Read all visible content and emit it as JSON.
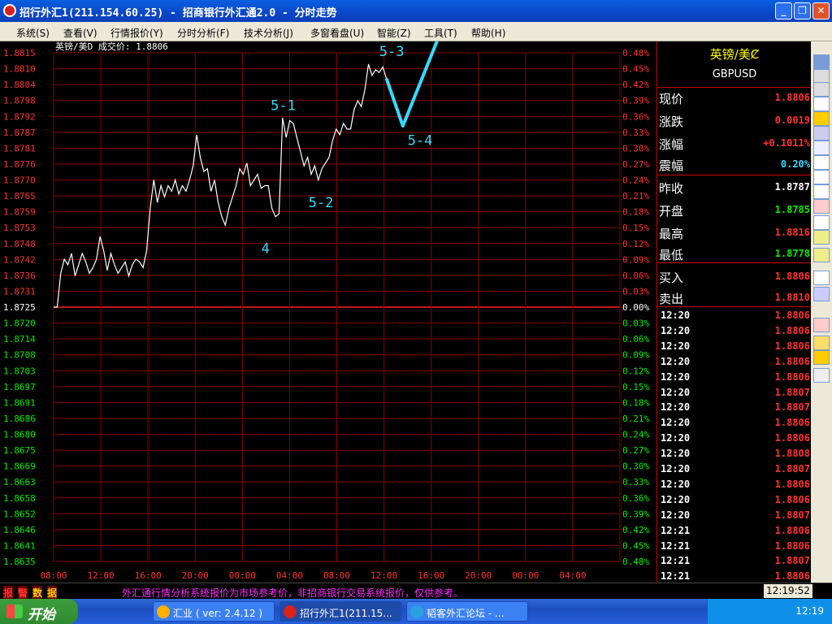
{
  "window": {
    "title": "招行外汇1(211.154.60.25) - 招商银行外汇通2.0 - 分时走势",
    "buttons": [
      "minimize",
      "restore",
      "close"
    ]
  },
  "menu": [
    "系统(S)",
    "查看(V)",
    "行情报价(Y)",
    "分时分析(F)",
    "技术分析(J)",
    "多窗看盘(U)",
    "智能(Z)",
    "工具(T)",
    "帮助(H)"
  ],
  "chart_header": {
    "label": "英镑/美D 成交价: 1.8806"
  },
  "chart_data": {
    "type": "line",
    "title": "英镑/美D 成交价: 1.8806",
    "base_price": 1.8725,
    "y_ticks_left": [
      "1.8815",
      "1.8810",
      "1.8804",
      "1.8798",
      "1.8792",
      "1.8787",
      "1.8781",
      "1.8776",
      "1.8770",
      "1.8765",
      "1.8759",
      "1.8753",
      "1.8748",
      "1.8742",
      "1.8736",
      "1.8731",
      "1.8725",
      "1.8720",
      "1.8714",
      "1.8708",
      "1.8703",
      "1.8697",
      "1.8691",
      "1.8686",
      "1.8680",
      "1.8675",
      "1.8669",
      "1.8663",
      "1.8658",
      "1.8652",
      "1.8646",
      "1.8641",
      "1.8635"
    ],
    "y_ticks_right": [
      "0.48%",
      "0.45%",
      "0.42%",
      "0.39%",
      "0.36%",
      "0.33%",
      "0.30%",
      "0.27%",
      "0.24%",
      "0.21%",
      "0.18%",
      "0.15%",
      "0.12%",
      "0.09%",
      "0.06%",
      "0.03%",
      "0.00%",
      "0.03%",
      "0.06%",
      "0.09%",
      "0.12%",
      "0.15%",
      "0.18%",
      "0.21%",
      "0.24%",
      "0.27%",
      "0.30%",
      "0.33%",
      "0.36%",
      "0.39%",
      "0.42%",
      "0.45%",
      "0.48%"
    ],
    "x_ticks": [
      "08:00",
      "12:00",
      "16:00",
      "20:00",
      "00:00",
      "04:00",
      "08:00",
      "12:00",
      "16:00",
      "20:00",
      "00:00",
      "04:00"
    ],
    "series": [
      {
        "values": [
          1.8725,
          1.8725,
          1.8737,
          1.8742,
          1.874,
          1.8744,
          1.8736,
          1.874,
          1.8744,
          1.8741,
          1.8737,
          1.8739,
          1.8742,
          1.875,
          1.8745,
          1.8738,
          1.8744,
          1.874,
          1.8737,
          1.8739,
          1.8741,
          1.8736,
          1.874,
          1.8742,
          1.8741,
          1.8739,
          1.8745,
          1.876,
          1.877,
          1.8762,
          1.8768,
          1.8764,
          1.8768,
          1.8766,
          1.877,
          1.8765,
          1.8768,
          1.8766,
          1.877,
          1.8775,
          1.8786,
          1.8778,
          1.8773,
          1.8774,
          1.8766,
          1.877,
          1.8762,
          1.8757,
          1.8754,
          1.876,
          1.8764,
          1.8768,
          1.8774,
          1.8772,
          1.8776,
          1.8768,
          1.877,
          1.8772,
          1.8767,
          1.8768,
          1.8768,
          1.876,
          1.8757,
          1.8758,
          1.8792,
          1.8785,
          1.8791,
          1.879,
          1.8785,
          1.878,
          1.8775,
          1.8778,
          1.8772,
          1.8775,
          1.877,
          1.8774,
          1.8776,
          1.8778,
          1.8784,
          1.8788,
          1.8786,
          1.879,
          1.8788,
          1.8788,
          1.8795,
          1.8798,
          1.8796,
          1.8802,
          1.8811,
          1.8807,
          1.8809,
          1.8808,
          1.881,
          1.8806
        ]
      }
    ],
    "annotations": [
      "5-1",
      "5-2",
      "5-3",
      "5-4",
      "4"
    ]
  },
  "quote": {
    "name_cn": "英镑/美Ȼ",
    "name_en": "GBPUSD",
    "rows": [
      {
        "label": "现价",
        "value": "1.8806",
        "color": "#ff3030"
      },
      {
        "label": "涨跌",
        "value": "0.0019",
        "color": "#ff3030"
      },
      {
        "label": "涨幅",
        "value": "+0.1011%",
        "color": "#ff3030"
      },
      {
        "label": "震幅",
        "value": "0.20%",
        "color": "#33ddff"
      },
      {
        "label": "昨收",
        "value": "1.8787",
        "color": "#ffffff"
      },
      {
        "label": "开盘",
        "value": "1.8785",
        "color": "#00ee00"
      },
      {
        "label": "最高",
        "value": "1.8816",
        "color": "#ff3030"
      },
      {
        "label": "最低",
        "value": "1.8778",
        "color": "#00ee00"
      },
      {
        "label": "买入",
        "value": "1.8806",
        "color": "#ff3030"
      },
      {
        "label": "卖出",
        "value": "1.8810",
        "color": "#ff3030"
      }
    ],
    "ticks": [
      {
        "time": "12:20",
        "price": "1.8806"
      },
      {
        "time": "12:20",
        "price": "1.8806"
      },
      {
        "time": "12:20",
        "price": "1.8806"
      },
      {
        "time": "12:20",
        "price": "1.8806"
      },
      {
        "time": "12:20",
        "price": "1.8806"
      },
      {
        "time": "12:20",
        "price": "1.8807"
      },
      {
        "time": "12:20",
        "price": "1.8807"
      },
      {
        "time": "12:20",
        "price": "1.8806"
      },
      {
        "time": "12:20",
        "price": "1.8806"
      },
      {
        "time": "12:20",
        "price": "1.8808"
      },
      {
        "time": "12:20",
        "price": "1.8807"
      },
      {
        "time": "12:20",
        "price": "1.8806"
      },
      {
        "time": "12:20",
        "price": "1.8806"
      },
      {
        "time": "12:20",
        "price": "1.8807"
      },
      {
        "time": "12:21",
        "price": "1.8806"
      },
      {
        "time": "12:21",
        "price": "1.8806"
      },
      {
        "time": "12:21",
        "price": "1.8807"
      },
      {
        "time": "12:21",
        "price": "1.8806"
      },
      {
        "time": "12:21",
        "price": "1.8806"
      }
    ]
  },
  "status": {
    "labels": [
      "报",
      "警",
      "数",
      "据"
    ],
    "message": "外汇通行情分析系统报价为市场参考价，非招商银行交易系统报价，仅供参考。",
    "clock": "12:19:52"
  },
  "taskbar": {
    "start": "开始",
    "tasks": [
      "汇业 ( ver: 2.4.12 )",
      "招行外汇1(211.15...",
      "韬客外汇论坛 - ..."
    ],
    "clock": "12:19"
  },
  "colors": {
    "grid": "#c00000",
    "up_text": "#ff3030",
    "down_text": "#00ee00",
    "annotation": "#33ddff"
  }
}
